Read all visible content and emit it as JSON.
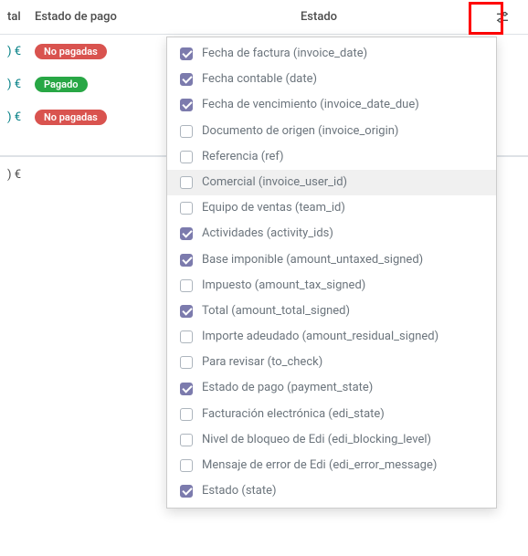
{
  "header": {
    "total_col": "tal",
    "payment_col": "Estado de pago",
    "status_col": "Estado"
  },
  "rows": [
    {
      "amount": ") €",
      "badge": "No pagadas",
      "badge_class": "badge-red"
    },
    {
      "amount": ") €",
      "badge": "Pagado",
      "badge_class": "badge-green"
    },
    {
      "amount": ") €",
      "badge": "No pagadas",
      "badge_class": "badge-red"
    }
  ],
  "summary": {
    "amount": ") €"
  },
  "dropdown": [
    {
      "label": "Fecha de factura (invoice_date)",
      "checked": true
    },
    {
      "label": "Fecha contable (date)",
      "checked": true
    },
    {
      "label": "Fecha de vencimiento (invoice_date_due)",
      "checked": true
    },
    {
      "label": "Documento de origen (invoice_origin)",
      "checked": false
    },
    {
      "label": "Referencia (ref)",
      "checked": false
    },
    {
      "label": "Comercial (invoice_user_id)",
      "checked": false,
      "hovered": true
    },
    {
      "label": "Equipo de ventas (team_id)",
      "checked": false
    },
    {
      "label": "Actividades (activity_ids)",
      "checked": true
    },
    {
      "label": "Base imponible (amount_untaxed_signed)",
      "checked": true
    },
    {
      "label": "Impuesto (amount_tax_signed)",
      "checked": false
    },
    {
      "label": "Total (amount_total_signed)",
      "checked": true
    },
    {
      "label": "Importe adeudado (amount_residual_signed)",
      "checked": false
    },
    {
      "label": "Para revisar (to_check)",
      "checked": false
    },
    {
      "label": "Estado de pago (payment_state)",
      "checked": true
    },
    {
      "label": "Facturación electrónica (edi_state)",
      "checked": false
    },
    {
      "label": "Nivel de bloqueo de Edi (edi_blocking_level)",
      "checked": false
    },
    {
      "label": "Mensaje de error de Edi (edi_error_message)",
      "checked": false
    },
    {
      "label": "Estado (state)",
      "checked": true
    }
  ]
}
